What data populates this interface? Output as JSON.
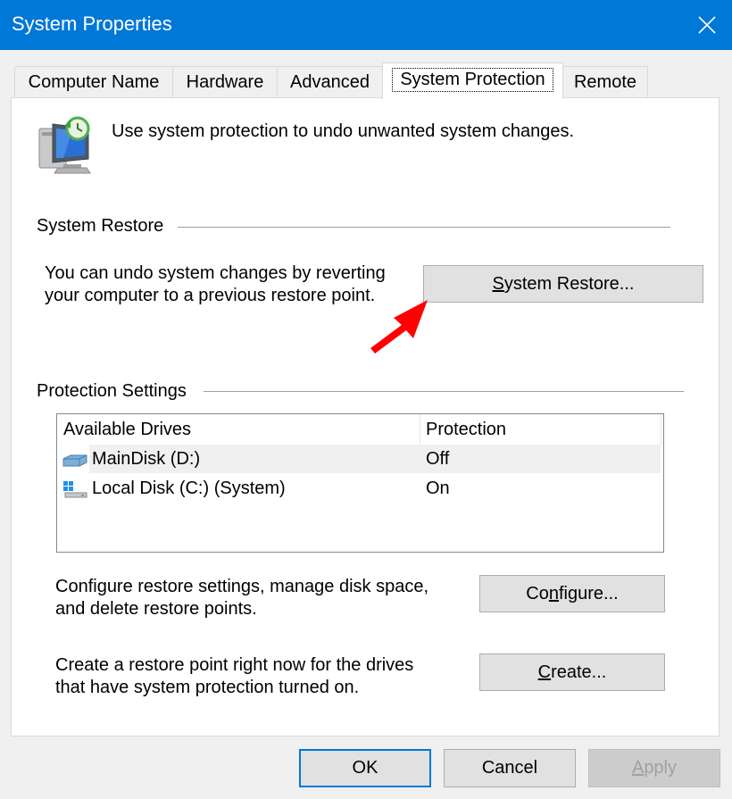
{
  "window": {
    "title": "System Properties",
    "close_icon": "close-icon"
  },
  "tabs": [
    {
      "label": "Computer Name"
    },
    {
      "label": "Hardware"
    },
    {
      "label": "Advanced"
    },
    {
      "label": "System Protection",
      "active": true
    },
    {
      "label": "Remote"
    }
  ],
  "intro": {
    "icon": "system-protection-icon",
    "text": "Use system protection to undo unwanted system changes."
  },
  "system_restore": {
    "heading": "System Restore",
    "description_line1": "You can undo system changes by reverting",
    "description_line2": "your computer to a previous restore point.",
    "button_mnemonic": "S",
    "button_rest": "ystem Restore...",
    "arrow_icon": "red-arrow-icon",
    "arrow_color": "#ff0000"
  },
  "protection_settings": {
    "heading": "Protection Settings",
    "columns": [
      "Available Drives",
      "Protection"
    ],
    "drives": [
      {
        "name": "MainDisk (D:)",
        "protection": "Off",
        "icon": "drive-icon",
        "selected": true
      },
      {
        "name": "Local Disk (C:) (System)",
        "protection": "On",
        "icon": "windows-drive-icon",
        "selected": false
      }
    ]
  },
  "configure": {
    "description_line1": "Configure restore settings, manage disk space,",
    "description_line2": "and delete restore points.",
    "button_pre": "Co",
    "button_mnemonic": "n",
    "button_rest": "figure..."
  },
  "create": {
    "description_line1": "Create a restore point right now for the drives",
    "description_line2": "that have system protection turned on.",
    "button_mnemonic": "C",
    "button_rest": "reate..."
  },
  "footer": {
    "ok": "OK",
    "cancel": "Cancel",
    "apply_mnemonic": "A",
    "apply_rest": "pply"
  },
  "colors": {
    "titlebar": "#0078d7",
    "accent": "#0078d7",
    "button_bg": "#e1e1e1"
  }
}
